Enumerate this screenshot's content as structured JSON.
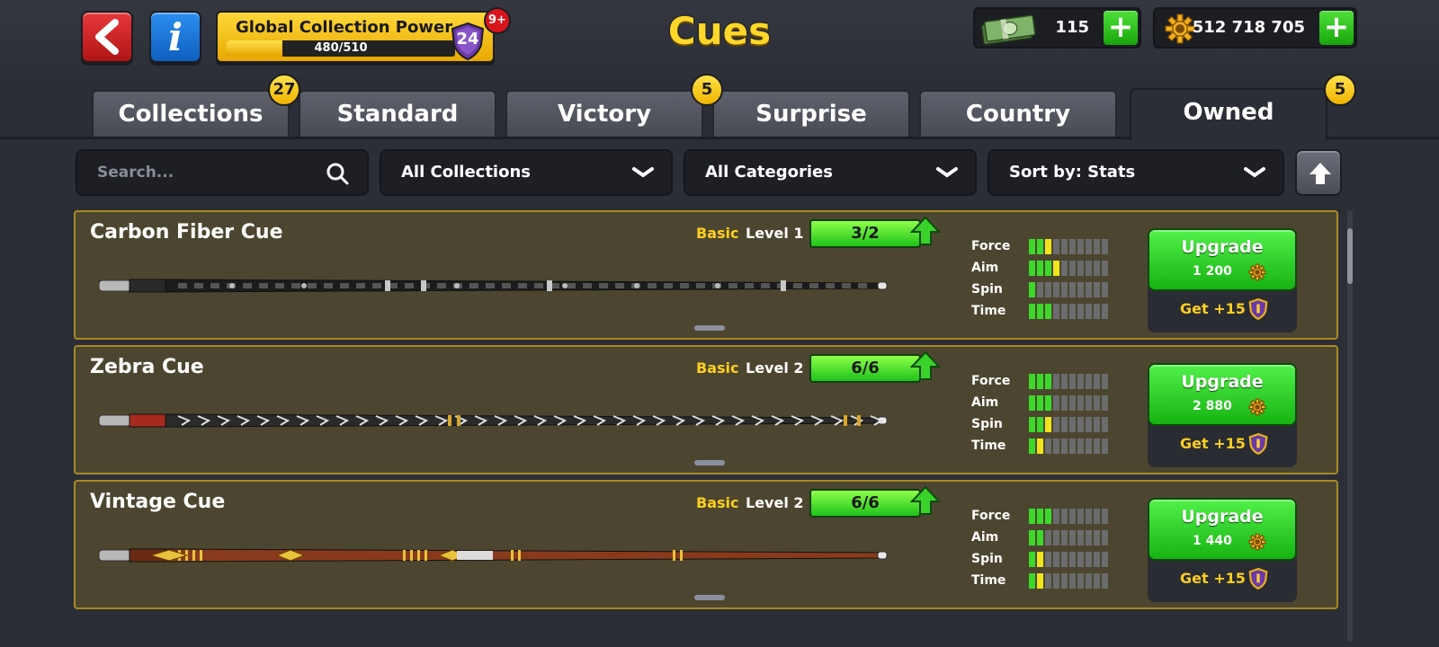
{
  "header": {
    "title": "Cues",
    "global_power": {
      "label": "Global Collection Power",
      "progress_text": "480/510",
      "progress": 0.941,
      "level": "24",
      "notification_badge": "9+"
    },
    "currencies": {
      "cash": "115",
      "coins": "512 718 705"
    }
  },
  "tabs": [
    {
      "label": "Collections",
      "badge": "27",
      "active": false
    },
    {
      "label": "Standard",
      "badge": "",
      "active": false
    },
    {
      "label": "Victory",
      "badge": "5",
      "active": false
    },
    {
      "label": "Surprise",
      "badge": "",
      "active": false
    },
    {
      "label": "Country",
      "badge": "",
      "active": false
    },
    {
      "label": "Owned",
      "badge": "5",
      "active": true
    }
  ],
  "filters": {
    "search_placeholder": "Search...",
    "collections": "All Collections",
    "categories": "All Categories",
    "sort": "Sort by: Stats"
  },
  "cues": [
    {
      "name": "Carbon Fiber Cue",
      "rarity": "Basic",
      "level": "Level 1",
      "pieces": "3/2",
      "stats": {
        "force": 3,
        "aim": 4,
        "spin": 1,
        "time": 3
      },
      "highlight": {
        "force": true,
        "aim": true,
        "spin": false,
        "time": false
      },
      "upgrade_label": "Upgrade",
      "upgrade_cost": "1 200",
      "get_label": "Get +15",
      "style": "carbon"
    },
    {
      "name": "Zebra Cue",
      "rarity": "Basic",
      "level": "Level 2",
      "pieces": "6/6",
      "stats": {
        "force": 3,
        "aim": 3,
        "spin": 3,
        "time": 2
      },
      "highlight": {
        "force": false,
        "aim": false,
        "spin": true,
        "time": true
      },
      "upgrade_label": "Upgrade",
      "upgrade_cost": "2 880",
      "get_label": "Get +15",
      "style": "zebra"
    },
    {
      "name": "Vintage Cue",
      "rarity": "Basic",
      "level": "Level 2",
      "pieces": "6/6",
      "stats": {
        "force": 3,
        "aim": 2,
        "spin": 2,
        "time": 2
      },
      "highlight": {
        "force": false,
        "aim": false,
        "spin": true,
        "time": true
      },
      "upgrade_label": "Upgrade",
      "upgrade_cost": "1 440",
      "get_label": "Get +15",
      "style": "vintage"
    }
  ],
  "stat_labels": {
    "force": "Force",
    "aim": "Aim",
    "spin": "Spin",
    "time": "Time"
  },
  "colors": {
    "accent_yellow": "#ffcf1f",
    "green": "#2ccf1f",
    "card_border": "#a88a22"
  }
}
